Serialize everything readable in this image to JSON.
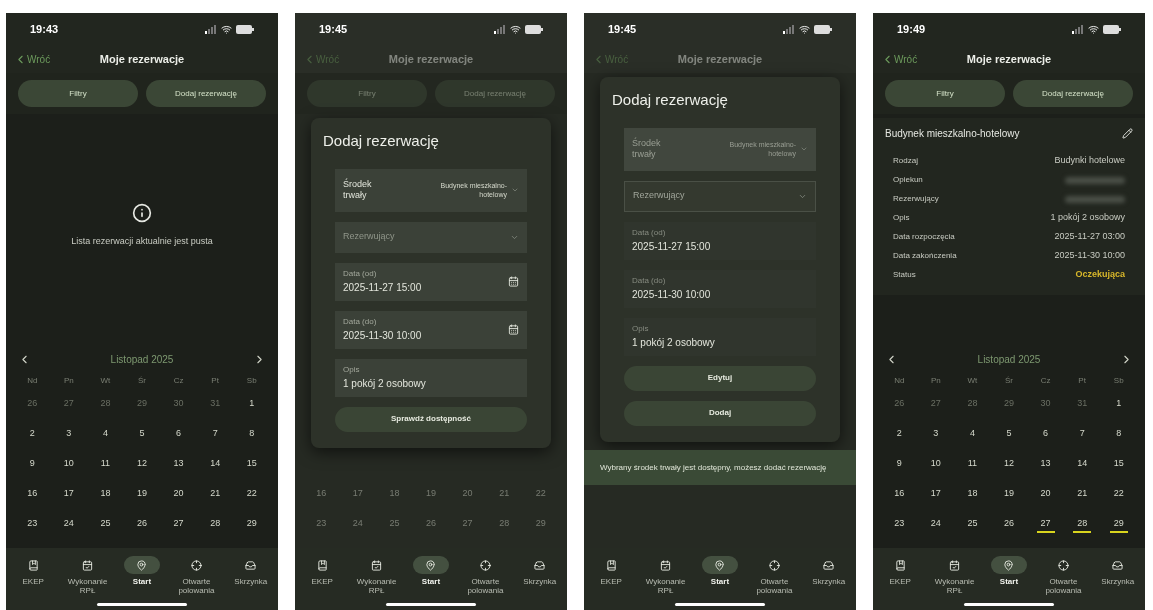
{
  "screens": [
    {
      "status_bar": {
        "time": "19:43"
      },
      "header": {
        "back": "Wróć",
        "title": "Moje rezerwacje"
      },
      "dimmed": false,
      "actions": [
        {
          "label": "Filtry"
        },
        {
          "label": "Dodaj rezerwację"
        }
      ],
      "empty_state": {
        "message": "Lista rezerwacji aktualnie jest pusta"
      },
      "calendar": {
        "month": "Listopad 2025",
        "weekdays": [
          "Nd",
          "Pn",
          "Wt",
          "Śr",
          "Cz",
          "Pt",
          "Sb"
        ],
        "weeks": [
          [
            {
              "day": "26",
              "muted": true,
              "in_range": false
            },
            {
              "day": "27",
              "muted": true,
              "in_range": false
            },
            {
              "day": "28",
              "muted": true,
              "in_range": false
            },
            {
              "day": "29",
              "muted": true,
              "in_range": false
            },
            {
              "day": "30",
              "muted": true,
              "in_range": false
            },
            {
              "day": "31",
              "muted": true,
              "in_range": false
            },
            {
              "day": "1",
              "muted": false,
              "in_range": false
            }
          ],
          [
            {
              "day": "2",
              "muted": false,
              "in_range": false
            },
            {
              "day": "3",
              "muted": false,
              "in_range": false
            },
            {
              "day": "4",
              "muted": false,
              "in_range": false
            },
            {
              "day": "5",
              "muted": false,
              "in_range": false
            },
            {
              "day": "6",
              "muted": false,
              "in_range": false
            },
            {
              "day": "7",
              "muted": false,
              "in_range": false
            },
            {
              "day": "8",
              "muted": false,
              "in_range": false
            }
          ],
          [
            {
              "day": "9",
              "muted": false,
              "in_range": false
            },
            {
              "day": "10",
              "muted": false,
              "in_range": false
            },
            {
              "day": "11",
              "muted": false,
              "in_range": false
            },
            {
              "day": "12",
              "muted": false,
              "in_range": false
            },
            {
              "day": "13",
              "muted": false,
              "in_range": false
            },
            {
              "day": "14",
              "muted": false,
              "in_range": false
            },
            {
              "day": "15",
              "muted": false,
              "in_range": false
            }
          ],
          [
            {
              "day": "16",
              "muted": false,
              "in_range": false
            },
            {
              "day": "17",
              "muted": false,
              "in_range": false
            },
            {
              "day": "18",
              "muted": false,
              "in_range": false
            },
            {
              "day": "19",
              "muted": false,
              "in_range": false
            },
            {
              "day": "20",
              "muted": false,
              "in_range": false
            },
            {
              "day": "21",
              "muted": false,
              "in_range": false
            },
            {
              "day": "22",
              "muted": false,
              "in_range": false
            }
          ],
          [
            {
              "day": "23",
              "muted": false,
              "in_range": false
            },
            {
              "day": "24",
              "muted": false,
              "in_range": false
            },
            {
              "day": "25",
              "muted": false,
              "in_range": false
            },
            {
              "day": "26",
              "muted": false,
              "in_range": false
            },
            {
              "day": "27",
              "muted": false,
              "in_range": false
            },
            {
              "day": "28",
              "muted": false,
              "in_range": false
            },
            {
              "day": "29",
              "muted": false,
              "in_range": false
            }
          ]
        ]
      },
      "nav": [
        {
          "label": "EKEP",
          "selected": false
        },
        {
          "label": "Wykonanie RPŁ",
          "selected": false
        },
        {
          "label": "Start",
          "selected": true
        },
        {
          "label": "Otwarte polowania",
          "selected": false
        },
        {
          "label": "Skrzynka",
          "selected": false
        }
      ]
    },
    {
      "status_bar": {
        "time": "19:45"
      },
      "header": {
        "back": "Wróć",
        "title": "Moje rezerwacje"
      },
      "dimmed": true,
      "actions": [
        {
          "label": "Filtry"
        },
        {
          "label": "Dodaj rezerwację"
        }
      ],
      "modal": {
        "title": "Dodaj rezerwację",
        "fields": [
          {
            "kind": "select",
            "label": "Środek trwały",
            "value": "Budynek mieszkalno-hotelowy",
            "disabled": false
          },
          {
            "kind": "select",
            "placeholder": "Rezerwujący",
            "disabled": false
          },
          {
            "kind": "date",
            "label": "Data (od)",
            "value": "2025-11-27 15:00",
            "disabled": false
          },
          {
            "kind": "date",
            "label": "Data (do)",
            "value": "2025-11-30 10:00",
            "disabled": false
          },
          {
            "kind": "text",
            "label": "Opis",
            "value": "1 pokój 2 osobowy",
            "disabled": false
          }
        ],
        "buttons": [
          {
            "label": "Sprawdź dostępność"
          }
        ]
      },
      "calendar": {
        "weeks": [
          [
            {
              "day": "16",
              "muted": false,
              "in_range": false
            },
            {
              "day": "17",
              "muted": false,
              "in_range": false
            },
            {
              "day": "18",
              "muted": false,
              "in_range": false
            },
            {
              "day": "19",
              "muted": false,
              "in_range": false
            },
            {
              "day": "20",
              "muted": false,
              "in_range": false
            },
            {
              "day": "21",
              "muted": false,
              "in_range": false
            },
            {
              "day": "22",
              "muted": false,
              "in_range": false
            }
          ],
          [
            {
              "day": "23",
              "muted": false,
              "in_range": false
            },
            {
              "day": "24",
              "muted": false,
              "in_range": false
            },
            {
              "day": "25",
              "muted": false,
              "in_range": false
            },
            {
              "day": "26",
              "muted": false,
              "in_range": false
            },
            {
              "day": "27",
              "muted": false,
              "in_range": false
            },
            {
              "day": "28",
              "muted": false,
              "in_range": false
            },
            {
              "day": "29",
              "muted": false,
              "in_range": false
            }
          ]
        ]
      },
      "nav": [
        {
          "label": "EKEP",
          "selected": false
        },
        {
          "label": "Wykonanie RPŁ",
          "selected": false
        },
        {
          "label": "Start",
          "selected": true
        },
        {
          "label": "Otwarte polowania",
          "selected": false
        },
        {
          "label": "Skrzynka",
          "selected": false
        }
      ]
    },
    {
      "status_bar": {
        "time": "19:45"
      },
      "header": {
        "back": "Wróć",
        "title": "Moje rezerwacje"
      },
      "dimmed": true,
      "modal": {
        "title": "Dodaj rezerwację",
        "fields": [
          {
            "kind": "select",
            "label": "Środek trwały",
            "value": "Budynek mieszkalno-hotelowy",
            "disabled": true
          },
          {
            "kind": "select",
            "placeholder": "Rezerwujący",
            "disabled": true
          },
          {
            "kind": "date",
            "label": "Data (od)",
            "value": "2025-11-27 15:00",
            "disabled": true
          },
          {
            "kind": "date",
            "label": "Data (do)",
            "value": "2025-11-30 10:00",
            "disabled": true
          },
          {
            "kind": "text",
            "label": "Opis",
            "value": "1 pokój 2 osobowy",
            "disabled": true
          }
        ],
        "buttons": [
          {
            "label": "Edytuj"
          },
          {
            "label": "Dodaj"
          }
        ]
      },
      "toast": {
        "message": "Wybrany środek trwały jest dostępny, możesz dodać rezerwację"
      },
      "nav": [
        {
          "label": "EKEP",
          "selected": false
        },
        {
          "label": "Wykonanie RPŁ",
          "selected": false
        },
        {
          "label": "Start",
          "selected": true
        },
        {
          "label": "Otwarte polowania",
          "selected": false
        },
        {
          "label": "Skrzynka",
          "selected": false
        }
      ]
    },
    {
      "status_bar": {
        "time": "19:49"
      },
      "header": {
        "back": "Wróć",
        "title": "Moje rezerwacje"
      },
      "dimmed": false,
      "actions": [
        {
          "label": "Filtry"
        },
        {
          "label": "Dodaj rezerwację"
        }
      ],
      "details": {
        "title": "Budynek mieszkalno-hotelowy",
        "rows": [
          {
            "label": "Rodzaj",
            "value": "Budynki hotelowe",
            "redacted": false
          },
          {
            "label": "Opiekun",
            "redacted": true
          },
          {
            "label": "Rezerwujący",
            "redacted": true
          },
          {
            "label": "Opis",
            "value": "1 pokój 2 osobowy",
            "redacted": false
          },
          {
            "label": "Data rozpoczęcia",
            "value": "2025-11-27 03:00",
            "redacted": false
          },
          {
            "label": "Data zakończenia",
            "value": "2025-11-30 10:00",
            "redacted": false
          },
          {
            "label": "Status",
            "value": "Oczekująca",
            "redacted": false,
            "color": "#d8b72a"
          }
        ]
      },
      "calendar": {
        "month": "Listopad 2025",
        "weekdays": [
          "Nd",
          "Pn",
          "Wt",
          "Śr",
          "Cz",
          "Pt",
          "Sb"
        ],
        "weeks": [
          [
            {
              "day": "26",
              "muted": true,
              "in_range": false
            },
            {
              "day": "27",
              "muted": true,
              "in_range": false
            },
            {
              "day": "28",
              "muted": true,
              "in_range": false
            },
            {
              "day": "29",
              "muted": true,
              "in_range": false
            },
            {
              "day": "30",
              "muted": true,
              "in_range": false
            },
            {
              "day": "31",
              "muted": true,
              "in_range": false
            },
            {
              "day": "1",
              "muted": false,
              "in_range": false
            }
          ],
          [
            {
              "day": "2",
              "muted": false,
              "in_range": false
            },
            {
              "day": "3",
              "muted": false,
              "in_range": false
            },
            {
              "day": "4",
              "muted": false,
              "in_range": false
            },
            {
              "day": "5",
              "muted": false,
              "in_range": false
            },
            {
              "day": "6",
              "muted": false,
              "in_range": false
            },
            {
              "day": "7",
              "muted": false,
              "in_range": false
            },
            {
              "day": "8",
              "muted": false,
              "in_range": false
            }
          ],
          [
            {
              "day": "9",
              "muted": false,
              "in_range": false
            },
            {
              "day": "10",
              "muted": false,
              "in_range": false
            },
            {
              "day": "11",
              "muted": false,
              "in_range": false
            },
            {
              "day": "12",
              "muted": false,
              "in_range": false
            },
            {
              "day": "13",
              "muted": false,
              "in_range": false
            },
            {
              "day": "14",
              "muted": false,
              "in_range": false
            },
            {
              "day": "15",
              "muted": false,
              "in_range": false
            }
          ],
          [
            {
              "day": "16",
              "muted": false,
              "in_range": false
            },
            {
              "day": "17",
              "muted": false,
              "in_range": false
            },
            {
              "day": "18",
              "muted": false,
              "in_range": false
            },
            {
              "day": "19",
              "muted": false,
              "in_range": false
            },
            {
              "day": "20",
              "muted": false,
              "in_range": false
            },
            {
              "day": "21",
              "muted": false,
              "in_range": false
            },
            {
              "day": "22",
              "muted": false,
              "in_range": false
            }
          ],
          [
            {
              "day": "23",
              "muted": false,
              "in_range": false
            },
            {
              "day": "24",
              "muted": false,
              "in_range": false
            },
            {
              "day": "25",
              "muted": false,
              "in_range": false
            },
            {
              "day": "26",
              "muted": false,
              "in_range": false
            },
            {
              "day": "27",
              "muted": false,
              "in_range": true
            },
            {
              "day": "28",
              "muted": false,
              "in_range": true
            },
            {
              "day": "29",
              "muted": false,
              "in_range": true
            }
          ]
        ]
      },
      "nav": [
        {
          "label": "EKEP",
          "selected": false
        },
        {
          "label": "Wykonanie RPŁ",
          "selected": false
        },
        {
          "label": "Start",
          "selected": true
        },
        {
          "label": "Otwarte polowania",
          "selected": false
        },
        {
          "label": "Skrzynka",
          "selected": false
        }
      ]
    }
  ]
}
